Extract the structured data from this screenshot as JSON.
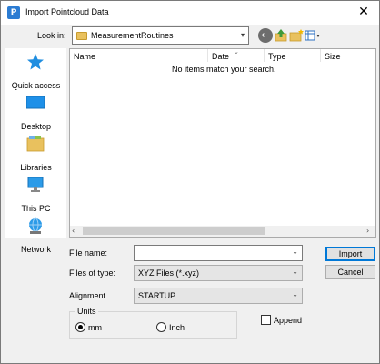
{
  "window": {
    "title": "Import Pointcloud Data",
    "app_icon_letter": "P",
    "close_glyph": "✕"
  },
  "toolbar": {
    "look_in_label": "Look in:",
    "look_in_value": "MeasurementRoutines",
    "icons": [
      "back-icon",
      "up-folder-icon",
      "new-folder-icon",
      "views-menu-icon"
    ]
  },
  "places": [
    {
      "label": "Quick access",
      "icon": "star-icon"
    },
    {
      "label": "Desktop",
      "icon": "desktop-icon"
    },
    {
      "label": "Libraries",
      "icon": "libraries-icon"
    },
    {
      "label": "This PC",
      "icon": "computer-icon"
    },
    {
      "label": "Network",
      "icon": "network-icon"
    }
  ],
  "file_list": {
    "columns": [
      "Name",
      "Date",
      "Type",
      "Size"
    ],
    "empty_message": "No items match your search."
  },
  "form": {
    "file_name_label": "File name:",
    "file_name_value": "",
    "files_of_type_label": "Files of type:",
    "files_of_type_value": "XYZ Files (*.xyz)",
    "alignment_label": "Alignment",
    "alignment_value": "STARTUP"
  },
  "buttons": {
    "import": "Import",
    "cancel": "Cancel"
  },
  "units": {
    "group_label": "Units",
    "options": [
      "mm",
      "Inch"
    ],
    "selected": "mm"
  },
  "append": {
    "label": "Append",
    "checked": false
  },
  "colors": {
    "accent": "#0078d7",
    "window_bg": "#f0f0f0",
    "list_bg": "#ffffff"
  }
}
